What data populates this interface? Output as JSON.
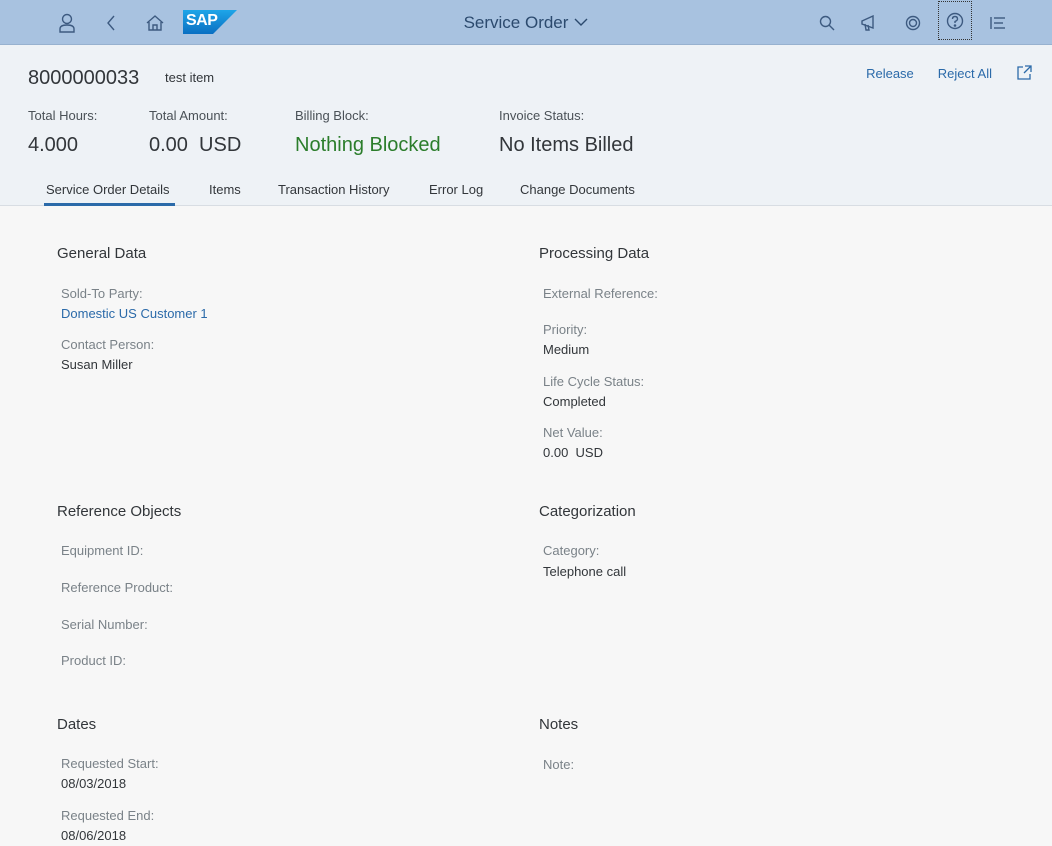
{
  "shell": {
    "title": "Service Order",
    "logo_text": "SAP",
    "icons": [
      "user-icon",
      "back-icon",
      "home-icon",
      "search-icon",
      "notifications-icon",
      "copilot-icon",
      "help-icon",
      "menu-icon"
    ]
  },
  "header": {
    "object_id": "8000000033",
    "object_subtitle": "test item",
    "actions": {
      "release": "Release",
      "reject_all": "Reject All"
    },
    "kpis": [
      {
        "label": "Total Hours:",
        "value": "4.000"
      },
      {
        "label": "Total Amount:",
        "value": "0.00  USD"
      },
      {
        "label": "Billing Block:",
        "value": "Nothing Blocked"
      },
      {
        "label": "Invoice Status:",
        "value": "No Items Billed"
      }
    ],
    "tabs": [
      "Service Order Details",
      "Items",
      "Transaction History",
      "Error Log",
      "Change Documents"
    ]
  },
  "general_data": {
    "title": "General Data",
    "sold_to_label": "Sold-To Party:",
    "sold_to_value": "Domestic US Customer 1",
    "contact_label": "Contact Person:",
    "contact_value": "Susan Miller"
  },
  "processing_data": {
    "title": "Processing Data",
    "ext_ref_label": "External Reference:",
    "priority_label": "Priority:",
    "priority_value": "Medium",
    "lifecycle_label": "Life Cycle Status:",
    "lifecycle_value": "Completed",
    "net_value_label": "Net Value:",
    "net_value_value": "0.00  USD"
  },
  "reference_objects": {
    "title": "Reference Objects",
    "equipment_label": "Equipment ID:",
    "ref_product_label": "Reference Product:",
    "serial_label": "Serial Number:",
    "product_id_label": "Product ID:"
  },
  "categorization": {
    "title": "Categorization",
    "category_label": "Category:",
    "category_value": "Telephone call"
  },
  "dates": {
    "title": "Dates",
    "req_start_label": "Requested Start:",
    "req_start_value": "08/03/2018",
    "req_end_label": "Requested End:",
    "req_end_value": "08/06/2018"
  },
  "notes": {
    "title": "Notes",
    "note_label": "Note:"
  }
}
